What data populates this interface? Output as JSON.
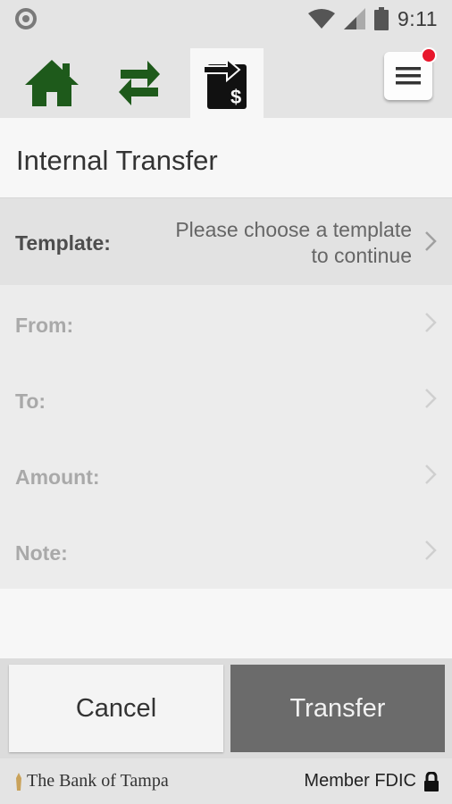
{
  "status_bar": {
    "time": "9:11",
    "icons": [
      "notification-dot-icon",
      "wifi-icon",
      "signal-icon",
      "battery-icon"
    ]
  },
  "nav": {
    "items": [
      {
        "name": "home",
        "icon": "home-icon",
        "color": "#1e5a1b"
      },
      {
        "name": "transfers",
        "icon": "swap-arrows-icon",
        "color": "#1e5a1b"
      },
      {
        "name": "pay",
        "icon": "bill-pay-icon",
        "active": true
      }
    ],
    "menu_icon": "hamburger-menu-icon",
    "badge_color": "#e8172c"
  },
  "page": {
    "title": "Internal Transfer"
  },
  "form": {
    "template": {
      "label": "Template:",
      "value_line1": "Please choose a template",
      "value_line2": "to continue"
    },
    "from": {
      "label": "From:"
    },
    "to": {
      "label": "To:"
    },
    "amount": {
      "label": "Amount:"
    },
    "note": {
      "label": "Note:"
    }
  },
  "actions": {
    "cancel": "Cancel",
    "transfer": "Transfer"
  },
  "footer": {
    "bank_name": "The Bank of Tampa",
    "fdic": "Member FDIC"
  },
  "colors": {
    "brand_green": "#1e5a1b",
    "transfer_button": "#6b6b6b",
    "badge": "#e8172c"
  }
}
